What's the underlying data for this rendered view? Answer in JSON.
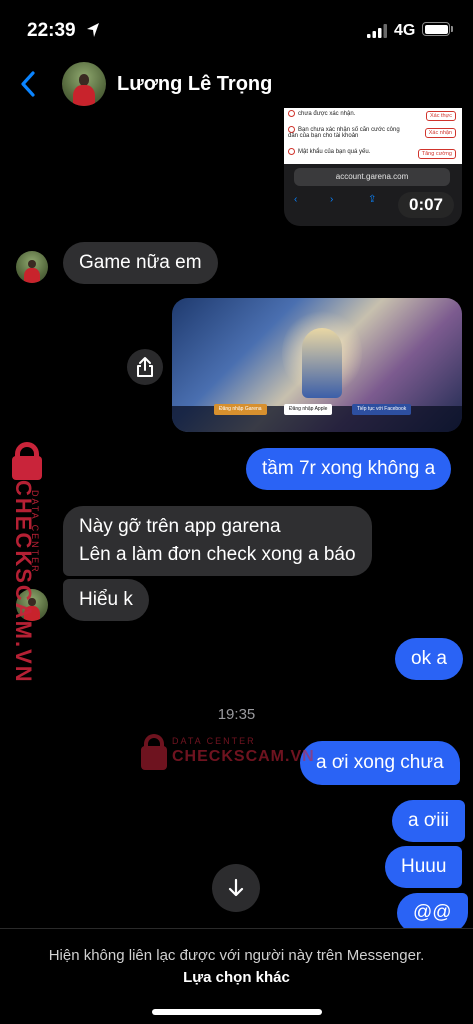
{
  "status_bar": {
    "time": "22:39",
    "network": "4G"
  },
  "header": {
    "contact_name": "Lương Lê Trọng"
  },
  "video_preview": {
    "rows": [
      {
        "text": "chưa được xác nhận.",
        "button": "Xác thực"
      },
      {
        "text": "Bạn chưa xác nhận số căn cước công dân của bạn cho tài khoản",
        "button": "Xác nhận"
      },
      {
        "text": "Mật khẩu của bạn quá yếu.",
        "button": "Tăng cường"
      }
    ],
    "url": "account.garena.com",
    "duration": "0:07"
  },
  "game_image": {
    "buttons": [
      "Đăng nhập Garena",
      "Đăng nhập Apple",
      "Tiếp tục với Facebook"
    ]
  },
  "messages": [
    {
      "direction": "in",
      "text": "Game nữa em"
    },
    {
      "direction": "out",
      "text": "tầm 7r xong không a"
    },
    {
      "direction": "in",
      "lines": [
        "Này gỡ trên app garena",
        "Lên a làm đơn check xong a báo"
      ]
    },
    {
      "direction": "in",
      "text": "Hiểu k"
    },
    {
      "direction": "out",
      "text": "ok a"
    },
    {
      "direction": "out",
      "text": "a ơi xong chưa"
    },
    {
      "direction": "out",
      "text": "a ơiii"
    },
    {
      "direction": "out",
      "text": "Huuu"
    },
    {
      "direction": "out",
      "text": "@@"
    }
  ],
  "timestamp": "19:35",
  "watermark": {
    "title": "DATA CENTER",
    "brand": "CHECKSCAM.VN"
  },
  "footer": {
    "text": "Hiện không liên lạc được với người này trên Messenger.",
    "link": "Lựa chọn khác"
  },
  "colors": {
    "outgoing": "#2a63f5",
    "incoming": "#2f2f31",
    "accent": "#0a84ff",
    "watermark": "#c9243a"
  }
}
